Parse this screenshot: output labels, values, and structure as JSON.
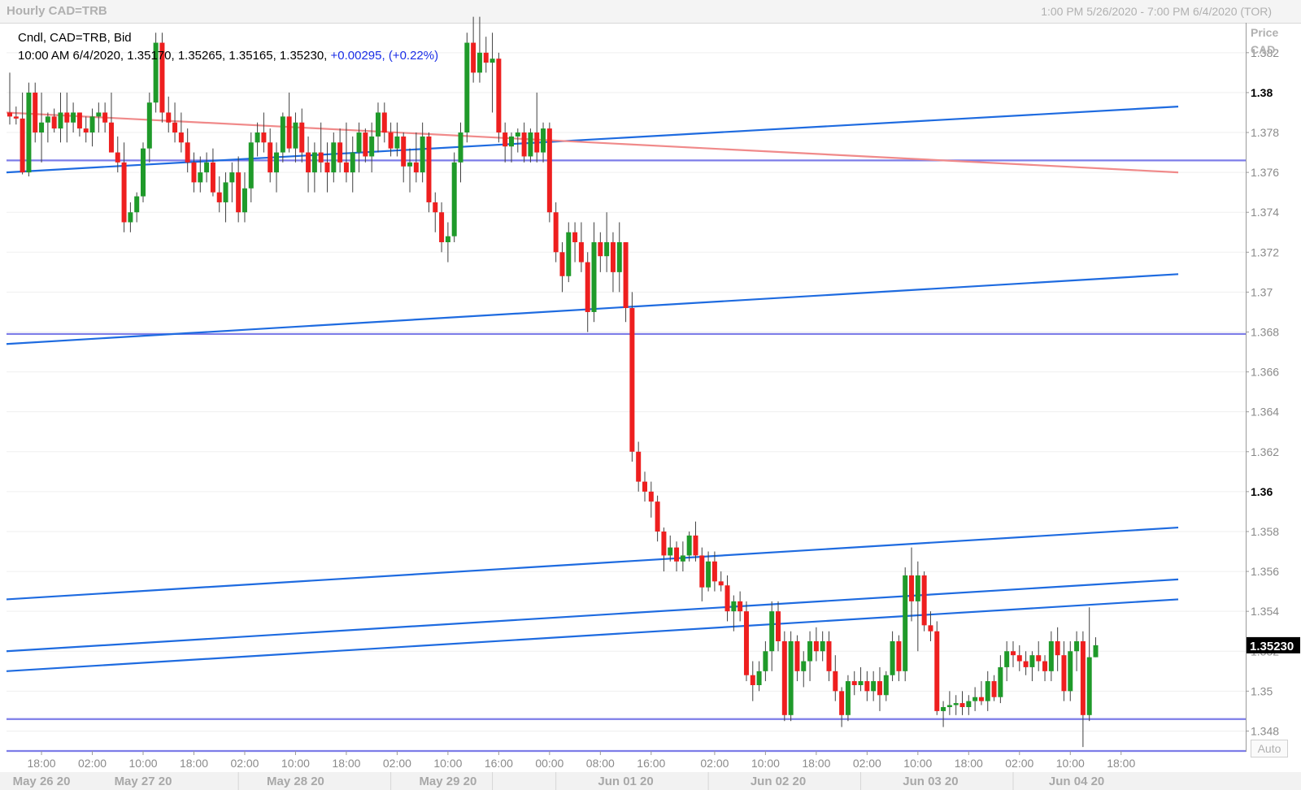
{
  "window": {
    "title": "Hourly CAD=TRB",
    "range": "1:00 PM 5/26/2020 - 7:00 PM 6/4/2020 (TOR)"
  },
  "legend": {
    "line1": "Cndl, CAD=TRB, Bid",
    "line2": "10:00 AM 6/4/2020, 1.35170, 1.35265, 1.35165, 1.35230,",
    "change": "+0.00295, (+0.22%)"
  },
  "axis": {
    "price_label": "Price",
    "currency_label": "CAD",
    "auto_label": "Auto",
    "last_price": "1.35230"
  },
  "colors": {
    "up_candle": "#1f9a2a",
    "down_candle": "#ee1f1f",
    "trend_blue": "#1e6be0",
    "horizontal_line": "#7d7de8",
    "downtrend_line": "#f08a8a",
    "last_price_box": "#000000"
  },
  "chart_data": {
    "type": "candlestick",
    "title": "Hourly CAD=TRB",
    "y_axis": {
      "label": "Price CAD",
      "range": [
        1.347,
        1.3835
      ],
      "ticks": [
        1.348,
        1.35,
        1.352,
        1.354,
        1.356,
        1.358,
        1.36,
        1.362,
        1.364,
        1.366,
        1.368,
        1.37,
        1.372,
        1.374,
        1.376,
        1.378,
        1.38,
        1.382
      ],
      "bold_ticks": [
        1.36,
        1.38
      ],
      "tick_labels": [
        "1.348",
        "1.35",
        "1.352",
        "1.354",
        "1.356",
        "1.358",
        "1.36",
        "1.362",
        "1.364",
        "1.366",
        "1.368",
        "1.37",
        "1.372",
        "1.374",
        "1.376",
        "1.378",
        "1.38",
        "1.382"
      ]
    },
    "x_axis": {
      "first_bar_time": "2020-05-26 13:00",
      "last_time": "2020-06-04 19:00",
      "time_ticks": [
        {
          "bar": 5,
          "label": "18:00"
        },
        {
          "bar": 13,
          "label": "02:00"
        },
        {
          "bar": 21,
          "label": "10:00"
        },
        {
          "bar": 29,
          "label": "18:00"
        },
        {
          "bar": 37,
          "label": "02:00"
        },
        {
          "bar": 45,
          "label": "10:00"
        },
        {
          "bar": 53,
          "label": "18:00"
        },
        {
          "bar": 61,
          "label": "02:00"
        },
        {
          "bar": 69,
          "label": "10:00"
        },
        {
          "bar": 77,
          "label": "16:00"
        },
        {
          "bar": 85,
          "label": "00:00"
        },
        {
          "bar": 93,
          "label": "08:00"
        },
        {
          "bar": 101,
          "label": "16:00"
        },
        {
          "bar": 111,
          "label": "02:00"
        },
        {
          "bar": 119,
          "label": "10:00"
        },
        {
          "bar": 127,
          "label": "18:00"
        },
        {
          "bar": 135,
          "label": "02:00"
        },
        {
          "bar": 143,
          "label": "10:00"
        },
        {
          "bar": 151,
          "label": "18:00"
        },
        {
          "bar": 159,
          "label": "02:00"
        },
        {
          "bar": 167,
          "label": "10:00"
        },
        {
          "bar": 175,
          "label": "18:00"
        }
      ],
      "date_labels": [
        {
          "bar": 5,
          "label": "May 26 20"
        },
        {
          "bar": 21,
          "label": "May 27 20"
        },
        {
          "bar": 45,
          "label": "May 28 20"
        },
        {
          "bar": 69,
          "label": "May 29 20"
        },
        {
          "bar": 97,
          "label": "Jun 01 20"
        },
        {
          "bar": 121,
          "label": "Jun 02 20"
        },
        {
          "bar": 145,
          "label": "Jun 03 20"
        },
        {
          "bar": 168,
          "label": "Jun 04 20"
        }
      ],
      "date_separators": [
        36,
        60,
        76,
        86,
        110,
        134,
        158
      ]
    },
    "candles": [
      [
        1.379,
        1.381,
        1.3784,
        1.3788
      ],
      [
        1.3788,
        1.3793,
        1.3784,
        1.3787
      ],
      [
        1.3787,
        1.38,
        1.3759,
        1.376
      ],
      [
        1.376,
        1.3805,
        1.3758,
        1.38
      ],
      [
        1.38,
        1.3805,
        1.3775,
        1.378
      ],
      [
        1.378,
        1.38,
        1.3765,
        1.3785
      ],
      [
        1.3785,
        1.379,
        1.3775,
        1.3788
      ],
      [
        1.3788,
        1.3792,
        1.378,
        1.3782
      ],
      [
        1.3782,
        1.38,
        1.3775,
        1.379
      ],
      [
        1.379,
        1.38,
        1.3775,
        1.3785
      ],
      [
        1.3785,
        1.3795,
        1.378,
        1.379
      ],
      [
        1.379,
        1.379,
        1.3778,
        1.3782
      ],
      [
        1.3782,
        1.3788,
        1.3775,
        1.378
      ],
      [
        1.378,
        1.3792,
        1.3773,
        1.3788
      ],
      [
        1.3788,
        1.3795,
        1.378,
        1.379
      ],
      [
        1.379,
        1.3795,
        1.378,
        1.3785
      ],
      [
        1.3785,
        1.38,
        1.377,
        1.377
      ],
      [
        1.377,
        1.3778,
        1.376,
        1.3765
      ],
      [
        1.3765,
        1.3775,
        1.373,
        1.3735
      ],
      [
        1.3735,
        1.3745,
        1.373,
        1.374
      ],
      [
        1.374,
        1.375,
        1.3735,
        1.3748
      ],
      [
        1.3748,
        1.3775,
        1.3745,
        1.3772
      ],
      [
        1.3772,
        1.38,
        1.3765,
        1.3795
      ],
      [
        1.3795,
        1.383,
        1.379,
        1.3825
      ],
      [
        1.3825,
        1.383,
        1.3785,
        1.379
      ],
      [
        1.379,
        1.3798,
        1.378,
        1.3785
      ],
      [
        1.3785,
        1.3795,
        1.3775,
        1.378
      ],
      [
        1.378,
        1.379,
        1.377,
        1.3775
      ],
      [
        1.3775,
        1.3782,
        1.376,
        1.3765
      ],
      [
        1.3765,
        1.377,
        1.375,
        1.3755
      ],
      [
        1.3755,
        1.3768,
        1.375,
        1.376
      ],
      [
        1.376,
        1.377,
        1.3755,
        1.3765
      ],
      [
        1.3765,
        1.3772,
        1.3748,
        1.375
      ],
      [
        1.375,
        1.3758,
        1.374,
        1.3745
      ],
      [
        1.3745,
        1.376,
        1.3735,
        1.3755
      ],
      [
        1.3755,
        1.3765,
        1.3745,
        1.376
      ],
      [
        1.376,
        1.3768,
        1.3735,
        1.374
      ],
      [
        1.374,
        1.376,
        1.3735,
        1.3752
      ],
      [
        1.3752,
        1.378,
        1.3745,
        1.3775
      ],
      [
        1.3775,
        1.3785,
        1.3768,
        1.378
      ],
      [
        1.378,
        1.379,
        1.377,
        1.3775
      ],
      [
        1.3775,
        1.3782,
        1.3755,
        1.376
      ],
      [
        1.376,
        1.3775,
        1.375,
        1.377
      ],
      [
        1.377,
        1.379,
        1.3765,
        1.3788
      ],
      [
        1.3788,
        1.38,
        1.377,
        1.3772
      ],
      [
        1.3772,
        1.379,
        1.3765,
        1.3785
      ],
      [
        1.3785,
        1.3792,
        1.3765,
        1.377
      ],
      [
        1.377,
        1.3778,
        1.375,
        1.376
      ],
      [
        1.376,
        1.3775,
        1.375,
        1.377
      ],
      [
        1.377,
        1.3785,
        1.376,
        1.3765
      ],
      [
        1.3765,
        1.3775,
        1.375,
        1.376
      ],
      [
        1.376,
        1.378,
        1.3755,
        1.3775
      ],
      [
        1.3775,
        1.3782,
        1.376,
        1.3765
      ],
      [
        1.3765,
        1.3785,
        1.3755,
        1.376
      ],
      [
        1.376,
        1.3778,
        1.375,
        1.377
      ],
      [
        1.377,
        1.3785,
        1.376,
        1.378
      ],
      [
        1.378,
        1.3782,
        1.3765,
        1.3768
      ],
      [
        1.3768,
        1.3785,
        1.376,
        1.3778
      ],
      [
        1.3778,
        1.3795,
        1.377,
        1.379
      ],
      [
        1.379,
        1.3795,
        1.3775,
        1.378
      ],
      [
        1.378,
        1.3785,
        1.3768,
        1.3772
      ],
      [
        1.3772,
        1.3785,
        1.3768,
        1.3778
      ],
      [
        1.3778,
        1.378,
        1.3755,
        1.3763
      ],
      [
        1.3763,
        1.3772,
        1.375,
        1.3765
      ],
      [
        1.3765,
        1.378,
        1.3755,
        1.376
      ],
      [
        1.376,
        1.3785,
        1.3755,
        1.3778
      ],
      [
        1.3778,
        1.378,
        1.374,
        1.3745
      ],
      [
        1.3745,
        1.375,
        1.373,
        1.374
      ],
      [
        1.374,
        1.3745,
        1.372,
        1.3725
      ],
      [
        1.3725,
        1.3735,
        1.3715,
        1.3728
      ],
      [
        1.3728,
        1.377,
        1.3725,
        1.3765
      ],
      [
        1.3765,
        1.3785,
        1.3755,
        1.378
      ],
      [
        1.378,
        1.383,
        1.3775,
        1.3825
      ],
      [
        1.3825,
        1.3838,
        1.3805,
        1.381
      ],
      [
        1.381,
        1.3838,
        1.3805,
        1.382
      ],
      [
        1.382,
        1.3828,
        1.381,
        1.3815
      ],
      [
        1.3815,
        1.383,
        1.379,
        1.3817
      ],
      [
        1.3817,
        1.382,
        1.3775,
        1.378
      ],
      [
        1.378,
        1.3785,
        1.3765,
        1.3773
      ],
      [
        1.3773,
        1.378,
        1.3765,
        1.3778
      ],
      [
        1.3778,
        1.3782,
        1.377,
        1.378
      ],
      [
        1.378,
        1.3785,
        1.3765,
        1.3768
      ],
      [
        1.3768,
        1.3782,
        1.3765,
        1.378
      ],
      [
        1.378,
        1.38,
        1.3765,
        1.377
      ],
      [
        1.377,
        1.3785,
        1.3765,
        1.3782
      ],
      [
        1.3782,
        1.3785,
        1.3735,
        1.374
      ],
      [
        1.374,
        1.3745,
        1.3715,
        1.372
      ],
      [
        1.372,
        1.3725,
        1.37,
        1.3708
      ],
      [
        1.3708,
        1.3735,
        1.3705,
        1.373
      ],
      [
        1.373,
        1.3735,
        1.3715,
        1.3725
      ],
      [
        1.3725,
        1.3735,
        1.371,
        1.3715
      ],
      [
        1.3715,
        1.372,
        1.368,
        1.369
      ],
      [
        1.369,
        1.3735,
        1.3685,
        1.3725
      ],
      [
        1.3725,
        1.373,
        1.371,
        1.3718
      ],
      [
        1.3718,
        1.374,
        1.371,
        1.3725
      ],
      [
        1.3725,
        1.373,
        1.37,
        1.371
      ],
      [
        1.371,
        1.3735,
        1.37,
        1.3725
      ],
      [
        1.3725,
        1.3725,
        1.3685,
        1.3692
      ],
      [
        1.3692,
        1.37,
        1.3615,
        1.362
      ],
      [
        1.362,
        1.3625,
        1.36,
        1.3605
      ],
      [
        1.3605,
        1.361,
        1.3595,
        1.36
      ],
      [
        1.36,
        1.3605,
        1.3587,
        1.3595
      ],
      [
        1.3595,
        1.3598,
        1.3575,
        1.358
      ],
      [
        1.358,
        1.3582,
        1.356,
        1.3568
      ],
      [
        1.3568,
        1.3578,
        1.3565,
        1.3572
      ],
      [
        1.3572,
        1.3575,
        1.356,
        1.3565
      ],
      [
        1.3565,
        1.3575,
        1.356,
        1.3568
      ],
      [
        1.3568,
        1.358,
        1.3565,
        1.3578
      ],
      [
        1.3578,
        1.3585,
        1.3565,
        1.3568
      ],
      [
        1.3568,
        1.3572,
        1.3545,
        1.3552
      ],
      [
        1.3552,
        1.357,
        1.355,
        1.3565
      ],
      [
        1.3565,
        1.357,
        1.355,
        1.3555
      ],
      [
        1.3555,
        1.356,
        1.355,
        1.3553
      ],
      [
        1.3553,
        1.3558,
        1.3535,
        1.354
      ],
      [
        1.354,
        1.3548,
        1.353,
        1.3545
      ],
      [
        1.3545,
        1.355,
        1.3535,
        1.354
      ],
      [
        1.354,
        1.3545,
        1.3505,
        1.3508
      ],
      [
        1.3508,
        1.3515,
        1.3495,
        1.3503
      ],
      [
        1.3503,
        1.3515,
        1.35,
        1.351
      ],
      [
        1.351,
        1.3525,
        1.3505,
        1.352
      ],
      [
        1.352,
        1.3545,
        1.351,
        1.354
      ],
      [
        1.354,
        1.3545,
        1.352,
        1.3525
      ],
      [
        1.3525,
        1.353,
        1.3485,
        1.3488
      ],
      [
        1.3488,
        1.353,
        1.3485,
        1.3525
      ],
      [
        1.3525,
        1.3528,
        1.3505,
        1.351
      ],
      [
        1.351,
        1.352,
        1.3502,
        1.3515
      ],
      [
        1.3515,
        1.353,
        1.3505,
        1.3525
      ],
      [
        1.3525,
        1.3532,
        1.3515,
        1.352
      ],
      [
        1.352,
        1.353,
        1.3515,
        1.3525
      ],
      [
        1.3525,
        1.353,
        1.3505,
        1.351
      ],
      [
        1.351,
        1.3518,
        1.3495,
        1.35
      ],
      [
        1.35,
        1.3502,
        1.3482,
        1.3488
      ],
      [
        1.3488,
        1.3508,
        1.3485,
        1.3505
      ],
      [
        1.3505,
        1.351,
        1.3498,
        1.3503
      ],
      [
        1.3503,
        1.3512,
        1.35,
        1.3505
      ],
      [
        1.3505,
        1.351,
        1.3495,
        1.35
      ],
      [
        1.35,
        1.351,
        1.3495,
        1.3505
      ],
      [
        1.3505,
        1.3512,
        1.349,
        1.3498
      ],
      [
        1.3498,
        1.351,
        1.3495,
        1.3508
      ],
      [
        1.3508,
        1.353,
        1.3505,
        1.3525
      ],
      [
        1.3525,
        1.3528,
        1.3505,
        1.351
      ],
      [
        1.351,
        1.3562,
        1.3505,
        1.3558
      ],
      [
        1.3558,
        1.3572,
        1.3535,
        1.3545
      ],
      [
        1.3545,
        1.3565,
        1.352,
        1.3558
      ],
      [
        1.3558,
        1.356,
        1.353,
        1.3533
      ],
      [
        1.3533,
        1.354,
        1.3525,
        1.353
      ],
      [
        1.353,
        1.3535,
        1.3488,
        1.349
      ],
      [
        1.349,
        1.3495,
        1.3482,
        1.3492
      ],
      [
        1.3492,
        1.35,
        1.3488,
        1.3493
      ],
      [
        1.3493,
        1.3498,
        1.3488,
        1.3494
      ],
      [
        1.3494,
        1.35,
        1.3488,
        1.3492
      ],
      [
        1.3492,
        1.3498,
        1.3488,
        1.3495
      ],
      [
        1.3495,
        1.3502,
        1.349,
        1.3497
      ],
      [
        1.3497,
        1.3505,
        1.3493,
        1.3495
      ],
      [
        1.3495,
        1.351,
        1.349,
        1.3505
      ],
      [
        1.3505,
        1.3508,
        1.3495,
        1.3497
      ],
      [
        1.3497,
        1.3518,
        1.3494,
        1.3512
      ],
      [
        1.3512,
        1.3525,
        1.3505,
        1.352
      ],
      [
        1.352,
        1.3525,
        1.3512,
        1.3518
      ],
      [
        1.3518,
        1.3523,
        1.351,
        1.3515
      ],
      [
        1.3515,
        1.352,
        1.3508,
        1.3512
      ],
      [
        1.3512,
        1.352,
        1.3505,
        1.3518
      ],
      [
        1.3518,
        1.3525,
        1.351,
        1.3515
      ],
      [
        1.3515,
        1.3518,
        1.3505,
        1.351
      ],
      [
        1.351,
        1.353,
        1.3505,
        1.3525
      ],
      [
        1.3525,
        1.3532,
        1.351,
        1.3518
      ],
      [
        1.3518,
        1.3525,
        1.3495,
        1.35
      ],
      [
        1.35,
        1.3525,
        1.3495,
        1.352
      ],
      [
        1.352,
        1.353,
        1.351,
        1.3525
      ],
      [
        1.3525,
        1.353,
        1.3472,
        1.3488
      ],
      [
        1.3488,
        1.3542,
        1.3485,
        1.3517
      ],
      [
        1.3517,
        1.3527,
        1.3517,
        1.3523
      ]
    ],
    "trendlines": [
      {
        "kind": "ascending",
        "from": [
          0,
          1.376
        ],
        "to": [
          184,
          1.3793
        ]
      },
      {
        "kind": "ascending",
        "from": [
          0,
          1.3674
        ],
        "to": [
          184,
          1.3709
        ]
      },
      {
        "kind": "ascending",
        "from": [
          0,
          1.3546
        ],
        "to": [
          184,
          1.3582
        ]
      },
      {
        "kind": "ascending",
        "from": [
          0,
          1.352
        ],
        "to": [
          184,
          1.3556
        ]
      },
      {
        "kind": "ascending",
        "from": [
          0,
          1.351
        ],
        "to": [
          184,
          1.3546
        ]
      },
      {
        "kind": "descending",
        "from": [
          0,
          1.379
        ],
        "to": [
          184,
          1.376
        ]
      }
    ],
    "horizontal_levels": [
      1.3766,
      1.3679,
      1.3486,
      1.347
    ]
  }
}
